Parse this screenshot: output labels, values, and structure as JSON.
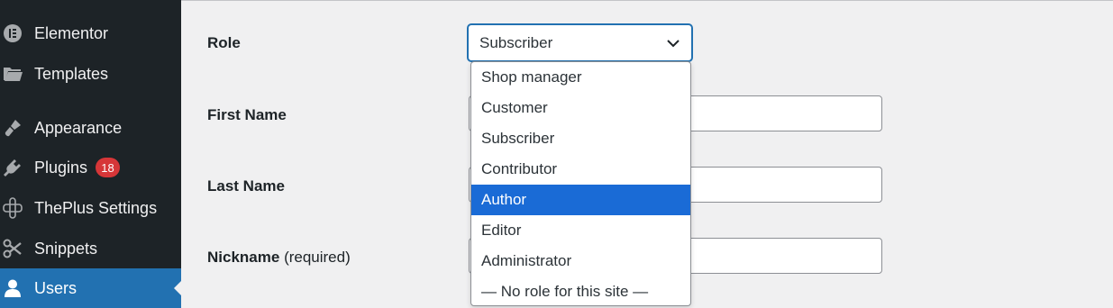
{
  "sidebar": {
    "items": [
      {
        "label": "Elementor",
        "icon": "elementor-icon"
      },
      {
        "label": "Templates",
        "icon": "folder-icon"
      },
      {
        "label": "Appearance",
        "icon": "paintbrush-icon"
      },
      {
        "label": "Plugins",
        "icon": "plugin-icon",
        "badge": "18"
      },
      {
        "label": "ThePlus Settings",
        "icon": "theplus-icon"
      },
      {
        "label": "Snippets",
        "icon": "scissors-icon"
      },
      {
        "label": "Users",
        "icon": "user-icon",
        "active": true
      }
    ]
  },
  "form": {
    "role_label": "Role",
    "role_value": "Subscriber",
    "first_name_label": "First Name",
    "last_name_label": "Last Name",
    "nickname_label": "Nickname",
    "nickname_required": "(required)"
  },
  "role_options": [
    "Shop manager",
    "Customer",
    "Subscriber",
    "Contributor",
    "Author",
    "Editor",
    "Administrator",
    "— No role for this site —"
  ],
  "highlighted_option": "Author",
  "colors": {
    "sidebar_bg": "#1d2327",
    "active_bg": "#2271b1",
    "highlight": "#1a6bd6",
    "badge": "#d63638"
  }
}
